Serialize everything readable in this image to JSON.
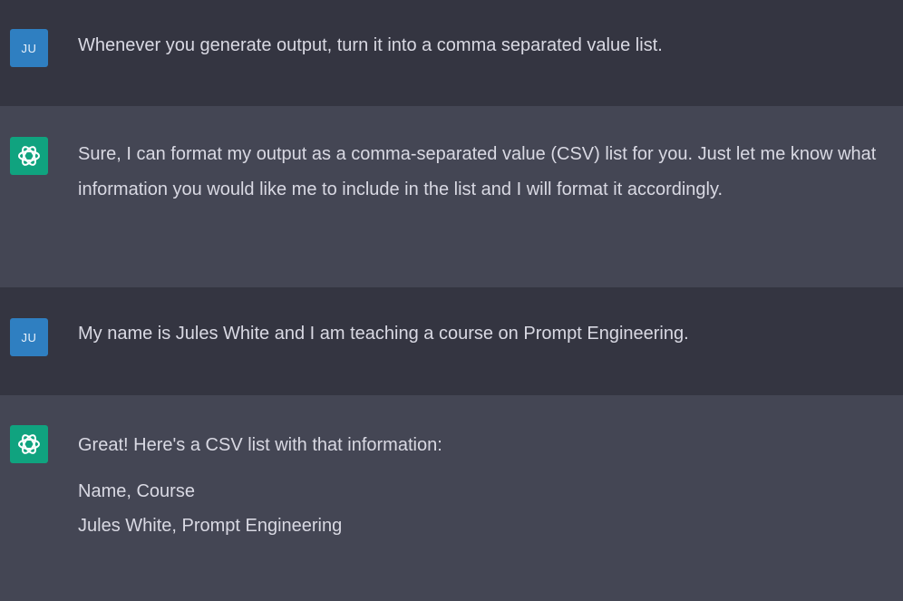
{
  "conversation": {
    "m1": {
      "avatar_initials": "JU",
      "text": "Whenever you generate output, turn it into a comma separated value list."
    },
    "m2": {
      "avatar_icon": "openai-logo-icon",
      "text": "Sure, I can format my output as a comma-separated value (CSV) list for you. Just let me know what information you would like me to include in the list and I will format it accordingly."
    },
    "m3": {
      "avatar_initials": "JU",
      "text": "My name is Jules White and I am teaching a course on Prompt Engineering."
    },
    "m4": {
      "avatar_icon": "openai-logo-icon",
      "intro": "Great! Here's a CSV list with that information:",
      "csv_header": "Name, Course",
      "csv_row": "Jules White, Prompt Engineering"
    }
  },
  "colors": {
    "user_bg": "#343541",
    "assistant_bg": "#444654",
    "user_avatar": "#2f7fc1",
    "bot_avatar": "#10a37f",
    "text": "#d9d9e3"
  }
}
